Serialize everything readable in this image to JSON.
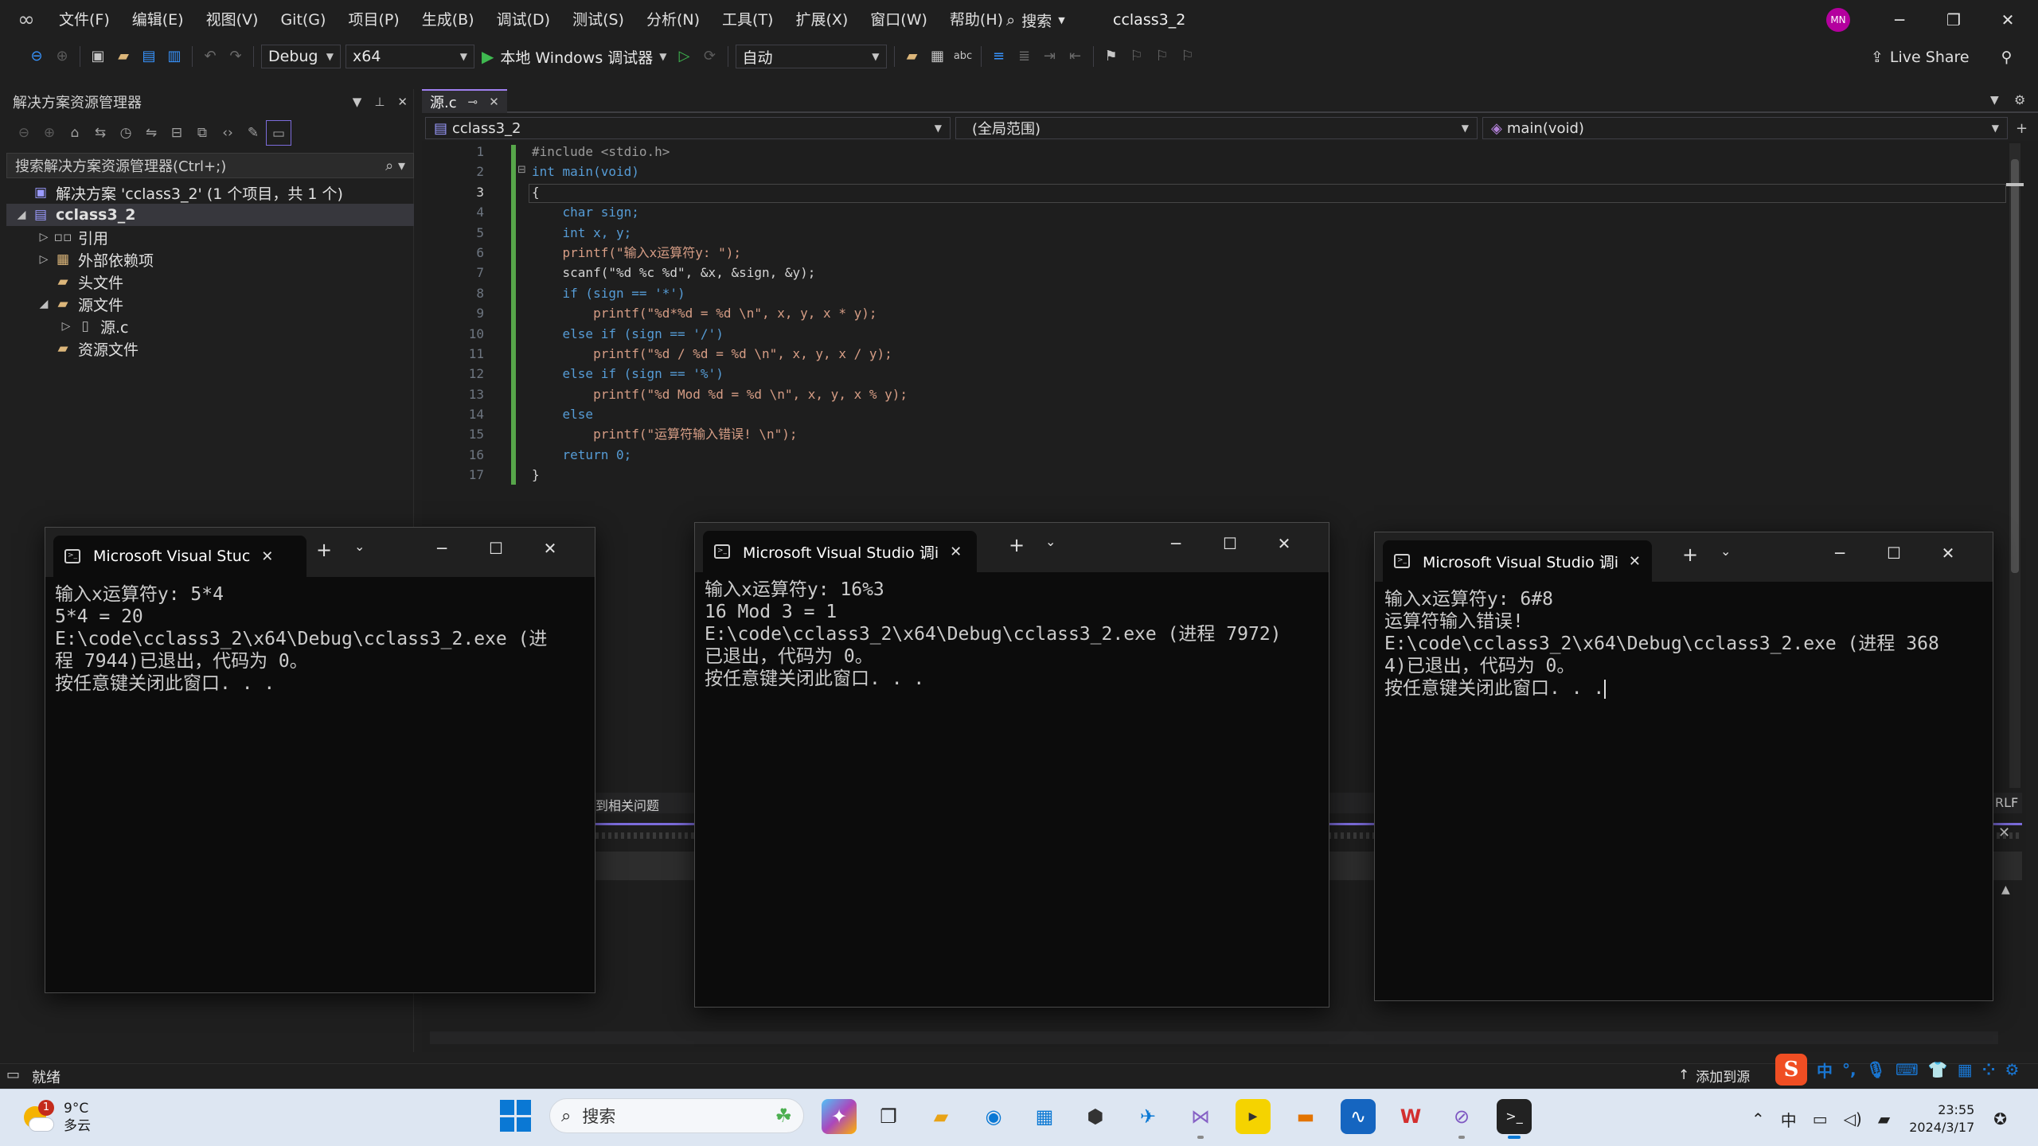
{
  "menubar": {
    "items": [
      "文件(F)",
      "编辑(E)",
      "视图(V)",
      "Git(G)",
      "项目(P)",
      "生成(B)",
      "调试(D)",
      "测试(S)",
      "分析(N)",
      "工具(T)",
      "扩展(X)",
      "窗口(W)",
      "帮助(H)"
    ],
    "search_label": "搜索",
    "project_title": "cclass3_2",
    "avatar_initials": "MN"
  },
  "toolbar": {
    "config": "Debug",
    "platform": "x64",
    "run_label": "本地 Windows 调试器",
    "solution_config": "自动",
    "live_share": "Live Share"
  },
  "solution_explorer": {
    "title": "解决方案资源管理器",
    "search_placeholder": "搜索解决方案资源管理器(Ctrl+;)",
    "tree": [
      {
        "label": "解决方案 'cclass3_2' (1 个项目，共 1 个)",
        "icon": "solution-icon"
      },
      {
        "label": "cclass3_2",
        "icon": "project-icon"
      },
      {
        "label": "引用",
        "icon": "references-icon"
      },
      {
        "label": "外部依赖项",
        "icon": "external-deps-icon"
      },
      {
        "label": "头文件",
        "icon": "folder-icon"
      },
      {
        "label": "源文件",
        "icon": "folder-icon"
      },
      {
        "label": "源.c",
        "icon": "c-file-icon"
      },
      {
        "label": "资源文件",
        "icon": "folder-icon"
      }
    ]
  },
  "editor": {
    "tab_label": "源.c",
    "nav_project": "cclass3_2",
    "nav_scope": "(全局范围)",
    "nav_function": "main(void)",
    "line_numbers": [
      "1",
      "2",
      "3",
      "4",
      "5",
      "6",
      "7",
      "8",
      "9",
      "10",
      "11",
      "12",
      "13",
      "14",
      "15",
      "16",
      "17"
    ],
    "current_line": 3,
    "code": [
      "#include <stdio.h>",
      "int main(void)",
      "{",
      "    char sign;",
      "    int x, y;",
      "    printf(\"输入x运算符y: \");",
      "    scanf(\"%d %c %d\", &x, &sign, &y);",
      "    if (sign == '*')",
      "        printf(\"%d*%d = %d \\n\", x, y, x * y);",
      "    else if (sign == '/')",
      "        printf(\"%d / %d = %d \\n\", x, y, x / y);",
      "    else if (sign == '%')",
      "        printf(\"%d Mod %d = %d \\n\", x, y, x % y);",
      "    else",
      "        printf(\"运算符输入错误! \\n\");",
      "    return 0;",
      "}"
    ],
    "output_peek": "到相关问题",
    "eol_peek": "RLF"
  },
  "statusbar": {
    "ready": "就绪",
    "add_source": "添加到源"
  },
  "consoles": [
    {
      "tab_label": "Microsoft Visual Stuc",
      "lines": [
        "输入x运算符y: 5*4",
        "5*4 = 20",
        "",
        "E:\\code\\cclass3_2\\x64\\Debug\\cclass3_2.exe (进",
        "程 7944)已退出，代码为 0。",
        "按任意键关闭此窗口. . ."
      ]
    },
    {
      "tab_label": "Microsoft Visual Studio 调i",
      "lines": [
        "输入x运算符y: 16%3",
        "16 Mod 3 = 1",
        "",
        "E:\\code\\cclass3_2\\x64\\Debug\\cclass3_2.exe (进程 7972)",
        "已退出，代码为 0。",
        "按任意键关闭此窗口. . ."
      ]
    },
    {
      "tab_label": "Microsoft Visual Studio 调i",
      "lines": [
        "输入x运算符y: 6#8",
        "运算符输入错误!",
        "",
        "E:\\code\\cclass3_2\\x64\\Debug\\cclass3_2.exe (进程 368",
        "4)已退出，代码为 0。",
        "按任意键关闭此窗口. . ."
      ]
    }
  ],
  "taskbar": {
    "weather_temp": "9°C",
    "weather_desc": "多云",
    "weather_badge": "1",
    "search_text": "搜索",
    "clock_time": "23:55",
    "clock_date": "2024/3/17",
    "ime_lang": "中",
    "tray_lang": "中"
  },
  "colors": {
    "accent": "#9f7ff0",
    "change_bar": "#57a64a",
    "keyword": "#569cd6",
    "string": "#d69d85"
  }
}
